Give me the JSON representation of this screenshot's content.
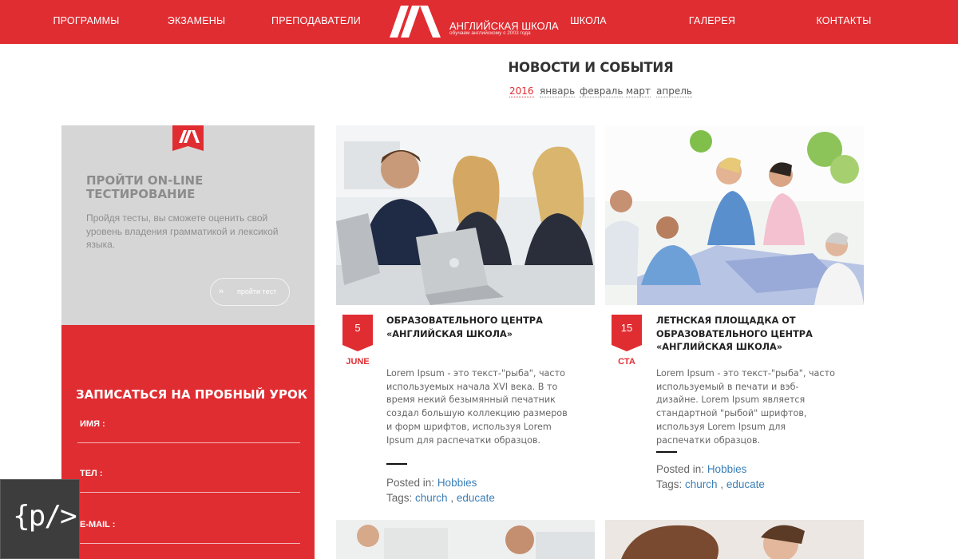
{
  "header": {
    "nav_left": [
      "ПРОГРАММЫ",
      "ЭКЗАМЕНЫ",
      "ПРЕПОДАВАТЕЛИ"
    ],
    "nav_right": [
      "ШКОЛА",
      "ГАЛЕРЕЯ",
      "КОНТАКТЫ"
    ],
    "logo_title": "Английская школа",
    "logo_subtitle": "обучаем английскому с 2003 года"
  },
  "news": {
    "title": "НОВОСТИ И СОБЫТИЯ",
    "filters": [
      "2016",
      "январь",
      "февраль",
      "март",
      "апрель"
    ],
    "active_filter": "2016"
  },
  "test_box": {
    "title": "ПРОЙТИ ON-LINE\nТЕСТИРОВАНИЕ",
    "description": "Пройдя тесты, вы сможете оценить свой уровень владения грамматикой и лексикой языка.",
    "button_label": "пройти тест",
    "button_icon": "double-chevron-right"
  },
  "signup": {
    "title": "ЗАПИСАТЬСЯ НА ПРОБНЫЙ УРОК",
    "fields": [
      "ИМЯ :",
      "ТЕЛ :",
      "E-MAIL :"
    ]
  },
  "code_badge": {
    "text": "{p/>"
  },
  "cards": [
    {
      "day": "5",
      "month": "JUNE",
      "title": "ОБРАЗОВАТЕЛЬНОГО ЦЕНТРА «АНГЛИЙСКАЯ ШКОЛА»",
      "text": "Lorem Ipsum - это текст-\"рыба\", часто используемых начала XVI века. В то время некий безымянный печатник создал большую коллекцию размеров и форм шрифтов, используя Lorem Ipsum для распечатки образцов.",
      "posted_label": "Posted in:",
      "category": "Hobbies",
      "tags_label": "Tags:",
      "tags": [
        "church",
        "educate"
      ],
      "image": "students-with-laptops-photo"
    },
    {
      "day": "15",
      "month": "СТА",
      "title": "ЛЕТНСКАЯ ПЛОЩАДКА ОТ ОБРАЗОВАТЕЛЬНОГО ЦЕНТРА «АНГЛИЙСКАЯ ШКОЛА»",
      "text": "Lorem Ipsum - это текст-\"рыба\", часто используемый в печати и вэб-дизайне. Lorem Ipsum является стандартной \"рыбой\" шрифтов, используя Lorem Ipsum для распечатки образцов.",
      "posted_label": "Posted in:",
      "category": "Hobbies",
      "tags_label": "Tags:",
      "tags": [
        "church",
        "educate"
      ],
      "image": "team-workshop-photo"
    }
  ],
  "colors": {
    "brand_red": "#e02d32",
    "link_blue": "#3b7fb8",
    "panel_grey": "#d6d6d6"
  }
}
